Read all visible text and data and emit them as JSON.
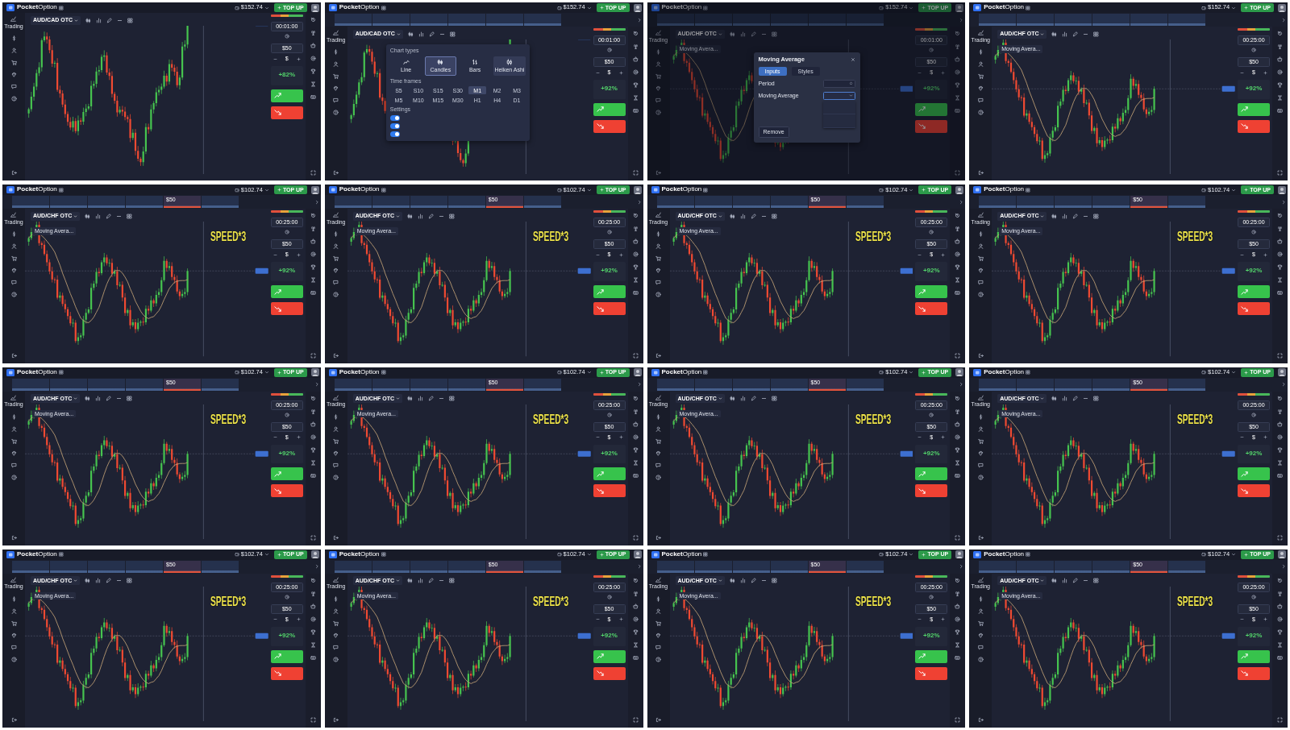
{
  "frames": [
    {
      "header": {
        "logo": "**Pocket**Option",
        "balance": "$152.74",
        "top_up": "TOP UP"
      },
      "sidebar": {
        "first_label": "Trading"
      },
      "pair": "AUD/CAD OTC",
      "chart": {
        "kind": "rebound"
      },
      "trade": {
        "timer": "00:01:00",
        "amount": "$50",
        "currency": "$",
        "payout": "+82%"
      }
    },
    {
      "header": {
        "logo": "**Pocket**Option",
        "balance": "$152.74",
        "top_up": "TOP UP"
      },
      "asset_strip": {
        "tabs": [
          {
            "open": false
          },
          {
            "open": false
          },
          {
            "open": false
          },
          {
            "open": false
          },
          {
            "open": false
          },
          {
            "open": false
          }
        ]
      },
      "sidebar": {
        "first_label": "Trading"
      },
      "pair": "AUD/CAD OTC",
      "chart": {
        "kind": "rebound"
      },
      "trade": {
        "timer": "00:01:00",
        "amount": "$50",
        "currency": "$",
        "payout": "+92%"
      },
      "popup": {
        "kind": "chart_types",
        "title": "Chart types",
        "types": [
          {
            "kind": "line",
            "label": "Line",
            "selected": false,
            "hovered": false
          },
          {
            "kind": "candles",
            "label": "Candles",
            "selected": true,
            "hovered": false
          },
          {
            "kind": "bars",
            "label": "Bars",
            "selected": false,
            "hovered": false
          },
          {
            "kind": "heiken_ashi",
            "label": "Heiken Ashi",
            "selected": false,
            "hovered": true
          }
        ],
        "timeframes_title": "Time frames",
        "timeframes": [
          {
            "label": "S5",
            "selected": false
          },
          {
            "label": "S10",
            "selected": false
          },
          {
            "label": "S15",
            "selected": false
          },
          {
            "label": "S30",
            "selected": false
          },
          {
            "label": "M1",
            "selected": true
          },
          {
            "label": "M2",
            "selected": false
          },
          {
            "label": "M3",
            "selected": false
          },
          {
            "label": "M5",
            "selected": false
          },
          {
            "label": "M10",
            "selected": false
          },
          {
            "label": "M15",
            "selected": false
          },
          {
            "label": "M30",
            "selected": false
          },
          {
            "label": "H1",
            "selected": false
          },
          {
            "label": "H4",
            "selected": false
          },
          {
            "label": "D1",
            "selected": false
          }
        ],
        "settings_title": "Settings",
        "toggles": [
          {
            "on": true
          },
          {
            "on": true
          },
          {
            "on": true
          }
        ]
      }
    },
    {
      "header": {
        "logo": "**Pocket**Option",
        "balance": "$152.74",
        "top_up": "TOP UP"
      },
      "asset_strip": {
        "tabs": [
          {
            "open": false
          },
          {
            "open": false
          },
          {
            "open": false
          },
          {
            "open": false
          },
          {
            "open": false
          },
          {
            "open": false
          }
        ]
      },
      "sidebar": {
        "first_label": "Trading"
      },
      "pair": "AUD/CHF OTC",
      "indicator_legend": "Moving Avera...",
      "chart": {
        "kind": "selloff",
        "moving_average": true
      },
      "trade": {
        "timer": "00:01:00",
        "amount": "$50",
        "currency": "$",
        "payout": "+92%"
      },
      "popup": {
        "kind": "indicator_settings",
        "title": "Moving Average",
        "tabs": [
          {
            "label": "Inputs",
            "selected": true
          },
          {
            "label": "Styles",
            "selected": false
          }
        ],
        "fields": [
          {
            "kind": "number",
            "label": "Period",
            "expanded": false
          },
          {
            "kind": "select",
            "label": "Moving Average",
            "expanded": true
          }
        ],
        "remove": "Remove"
      }
    },
    {
      "header": {
        "logo": "**Pocket**Option",
        "balance": "$152.74",
        "top_up": "TOP UP"
      },
      "asset_strip": {
        "tabs": [
          {
            "open": false
          },
          {
            "open": false
          },
          {
            "open": false
          },
          {
            "open": false
          },
          {
            "open": false
          },
          {
            "open": false
          }
        ]
      },
      "sidebar": {
        "first_label": "Trading"
      },
      "pair": "AUD/CHF OTC",
      "indicator_legend": "Moving Avera...",
      "chart": {
        "kind": "selloff",
        "moving_average": true
      },
      "trade": {
        "timer": "00:25:00",
        "amount": "$50",
        "currency": "$",
        "payout": "+92%"
      }
    },
    {
      "header": {
        "logo": "**Pocket**Option",
        "balance": "$102.74",
        "top_up": "TOP UP"
      },
      "asset_strip": {
        "tabs": [
          {
            "open": false
          },
          {
            "open": false
          },
          {
            "open": false
          },
          {
            "open": false
          },
          {
            "open": true,
            "trade_amount": "$50"
          },
          {
            "open": false
          }
        ]
      },
      "sidebar": {
        "first_label": "Trading"
      },
      "pair": "AUD/CHF OTC",
      "indicator_legend": "Moving Avera...",
      "chart": {
        "kind": "selloff",
        "moving_average": true
      },
      "trade": {
        "timer": "00:25:00",
        "amount": "$50",
        "currency": "$",
        "payout": "+92%"
      },
      "caption": "SPEED*3"
    },
    {
      "header": {
        "logo": "**Pocket**Option",
        "balance": "$102.74",
        "top_up": "TOP UP"
      },
      "asset_strip": {
        "tabs": [
          {
            "open": false
          },
          {
            "open": false
          },
          {
            "open": false
          },
          {
            "open": false
          },
          {
            "open": true,
            "trade_amount": "$50"
          },
          {
            "open": false
          }
        ]
      },
      "sidebar": {
        "first_label": "Trading"
      },
      "pair": "AUD/CHF OTC",
      "indicator_legend": "Moving Avera...",
      "chart": {
        "kind": "selloff",
        "moving_average": true
      },
      "trade": {
        "timer": "00:25:00",
        "amount": "$50",
        "currency": "$",
        "payout": "+92%"
      },
      "caption": "SPEED*3"
    },
    {
      "header": {
        "logo": "**Pocket**Option",
        "balance": "$102.74",
        "top_up": "TOP UP"
      },
      "asset_strip": {
        "tabs": [
          {
            "open": false
          },
          {
            "open": false
          },
          {
            "open": false
          },
          {
            "open": false
          },
          {
            "open": true,
            "trade_amount": "$50"
          },
          {
            "open": false
          }
        ]
      },
      "sidebar": {
        "first_label": "Trading"
      },
      "pair": "AUD/CHF OTC",
      "indicator_legend": "Moving Avera...",
      "chart": {
        "kind": "selloff",
        "moving_average": true
      },
      "trade": {
        "timer": "00:25:00",
        "amount": "$50",
        "currency": "$",
        "payout": "+92%"
      },
      "caption": "SPEED*3"
    },
    {
      "header": {
        "logo": "**Pocket**Option",
        "balance": "$102.74",
        "top_up": "TOP UP"
      },
      "asset_strip": {
        "tabs": [
          {
            "open": false
          },
          {
            "open": false
          },
          {
            "open": false
          },
          {
            "open": false
          },
          {
            "open": true,
            "trade_amount": "$50"
          },
          {
            "open": false
          }
        ]
      },
      "sidebar": {
        "first_label": "Trading"
      },
      "pair": "AUD/CHF OTC",
      "indicator_legend": "Moving Avera...",
      "chart": {
        "kind": "selloff",
        "moving_average": true
      },
      "trade": {
        "timer": "00:25:00",
        "amount": "$50",
        "currency": "$",
        "payout": "+92%"
      },
      "caption": "SPEED*3"
    },
    {
      "header": {
        "logo": "**Pocket**Option",
        "balance": "$102.74",
        "top_up": "TOP UP"
      },
      "asset_strip": {
        "tabs": [
          {
            "open": false
          },
          {
            "open": false
          },
          {
            "open": false
          },
          {
            "open": false
          },
          {
            "open": true,
            "trade_amount": "$50"
          },
          {
            "open": false
          }
        ]
      },
      "sidebar": {
        "first_label": "Trading"
      },
      "pair": "AUD/CHF OTC",
      "indicator_legend": "Moving Avera...",
      "chart": {
        "kind": "selloff",
        "moving_average": true
      },
      "trade": {
        "timer": "00:25:00",
        "amount": "$50",
        "currency": "$",
        "payout": "+92%"
      },
      "caption": "SPEED*3"
    },
    {
      "header": {
        "logo": "**Pocket**Option",
        "balance": "$102.74",
        "top_up": "TOP UP"
      },
      "asset_strip": {
        "tabs": [
          {
            "open": false
          },
          {
            "open": false
          },
          {
            "open": false
          },
          {
            "open": false
          },
          {
            "open": true,
            "trade_amount": "$50"
          },
          {
            "open": false
          }
        ]
      },
      "sidebar": {
        "first_label": "Trading"
      },
      "pair": "AUD/CHF OTC",
      "indicator_legend": "Moving Avera...",
      "chart": {
        "kind": "selloff",
        "moving_average": true
      },
      "trade": {
        "timer": "00:25:00",
        "amount": "$50",
        "currency": "$",
        "payout": "+92%"
      },
      "caption": "SPEED*3"
    },
    {
      "header": {
        "logo": "**Pocket**Option",
        "balance": "$102.74",
        "top_up": "TOP UP"
      },
      "asset_strip": {
        "tabs": [
          {
            "open": false
          },
          {
            "open": false
          },
          {
            "open": false
          },
          {
            "open": false
          },
          {
            "open": true,
            "trade_amount": "$50"
          },
          {
            "open": false
          }
        ]
      },
      "sidebar": {
        "first_label": "Trading"
      },
      "pair": "AUD/CHF OTC",
      "indicator_legend": "Moving Avera...",
      "chart": {
        "kind": "selloff",
        "moving_average": true
      },
      "trade": {
        "timer": "00:25:00",
        "amount": "$50",
        "currency": "$",
        "payout": "+92%"
      },
      "caption": "SPEED*3"
    },
    {
      "header": {
        "logo": "**Pocket**Option",
        "balance": "$102.74",
        "top_up": "TOP UP"
      },
      "asset_strip": {
        "tabs": [
          {
            "open": false
          },
          {
            "open": false
          },
          {
            "open": false
          },
          {
            "open": false
          },
          {
            "open": true,
            "trade_amount": "$50"
          },
          {
            "open": false
          }
        ]
      },
      "sidebar": {
        "first_label": "Trading"
      },
      "pair": "AUD/CHF OTC",
      "indicator_legend": "Moving Avera...",
      "chart": {
        "kind": "selloff",
        "moving_average": true
      },
      "trade": {
        "timer": "00:25:00",
        "amount": "$50",
        "currency": "$",
        "payout": "+92%"
      },
      "caption": "SPEED*3"
    },
    {
      "header": {
        "logo": "**Pocket**Option",
        "balance": "$102.74",
        "top_up": "TOP UP"
      },
      "asset_strip": {
        "tabs": [
          {
            "open": false
          },
          {
            "open": false
          },
          {
            "open": false
          },
          {
            "open": false
          },
          {
            "open": true,
            "trade_amount": "$50"
          },
          {
            "open": false
          }
        ]
      },
      "sidebar": {
        "first_label": "Trading"
      },
      "pair": "AUD/CHF OTC",
      "indicator_legend": "Moving Avera...",
      "chart": {
        "kind": "selloff",
        "moving_average": true
      },
      "trade": {
        "timer": "00:25:00",
        "amount": "$50",
        "currency": "$",
        "payout": "+92%"
      },
      "caption": "SPEED*3"
    },
    {
      "header": {
        "logo": "**Pocket**Option",
        "balance": "$102.74",
        "top_up": "TOP UP"
      },
      "asset_strip": {
        "tabs": [
          {
            "open": false
          },
          {
            "open": false
          },
          {
            "open": false
          },
          {
            "open": false
          },
          {
            "open": true,
            "trade_amount": "$50"
          },
          {
            "open": false
          }
        ]
      },
      "sidebar": {
        "first_label": "Trading"
      },
      "pair": "AUD/CHF OTC",
      "indicator_legend": "Moving Avera...",
      "chart": {
        "kind": "selloff",
        "moving_average": true
      },
      "trade": {
        "timer": "00:25:00",
        "amount": "$50",
        "currency": "$",
        "payout": "+92%"
      },
      "caption": "SPEED*3"
    },
    {
      "header": {
        "logo": "**Pocket**Option",
        "balance": "$102.74",
        "top_up": "TOP UP"
      },
      "asset_strip": {
        "tabs": [
          {
            "open": false
          },
          {
            "open": false
          },
          {
            "open": false
          },
          {
            "open": false
          },
          {
            "open": true,
            "trade_amount": "$50"
          },
          {
            "open": false
          }
        ]
      },
      "sidebar": {
        "first_label": "Trading"
      },
      "pair": "AUD/CHF OTC",
      "indicator_legend": "Moving Avera...",
      "chart": {
        "kind": "selloff",
        "moving_average": true
      },
      "trade": {
        "timer": "00:25:00",
        "amount": "$50",
        "currency": "$",
        "payout": "+92%"
      },
      "caption": "SPEED*3"
    },
    {
      "header": {
        "logo": "**Pocket**Option",
        "balance": "$102.74",
        "top_up": "TOP UP"
      },
      "asset_strip": {
        "tabs": [
          {
            "open": false
          },
          {
            "open": false
          },
          {
            "open": false
          },
          {
            "open": false
          },
          {
            "open": true,
            "trade_amount": "$50"
          },
          {
            "open": false
          }
        ]
      },
      "sidebar": {
        "first_label": "Trading"
      },
      "pair": "AUD/CHF OTC",
      "indicator_legend": "Moving Avera...",
      "chart": {
        "kind": "selloff",
        "moving_average": true
      },
      "trade": {
        "timer": "00:25:00",
        "amount": "$50",
        "currency": "$",
        "payout": "+92%"
      },
      "caption": "SPEED*3"
    }
  ]
}
